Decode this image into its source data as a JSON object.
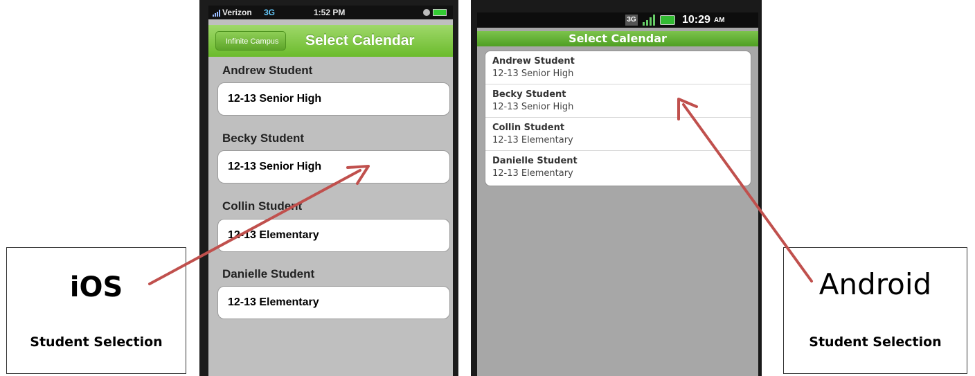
{
  "callouts": {
    "ios": {
      "platform": "iOS",
      "subtitle": "Student Selection"
    },
    "android": {
      "platform": "Android",
      "subtitle": "Student Selection"
    }
  },
  "ios": {
    "status": {
      "carrier": "Verizon",
      "network": "3G",
      "time": "1:52 PM"
    },
    "nav": {
      "back_label": "Infinite Campus",
      "title": "Select Calendar"
    },
    "students": [
      {
        "name": "Andrew Student",
        "calendar": "12-13 Senior High"
      },
      {
        "name": "Becky Student",
        "calendar": "12-13 Senior High"
      },
      {
        "name": "Collin Student",
        "calendar": "12-13 Elementary"
      },
      {
        "name": "Danielle Student",
        "calendar": "12-13 Elementary"
      }
    ]
  },
  "android": {
    "status": {
      "network": "3G",
      "time": "10:29",
      "ampm": "AM"
    },
    "title": "Select Calendar",
    "students": [
      {
        "name": "Andrew Student",
        "calendar": "12-13 Senior High"
      },
      {
        "name": "Becky Student",
        "calendar": "12-13 Senior High"
      },
      {
        "name": "Collin Student",
        "calendar": "12-13 Elementary"
      },
      {
        "name": "Danielle Student",
        "calendar": "12-13 Elementary"
      }
    ]
  },
  "colors": {
    "arrow": "#c0504d",
    "ios_nav": "#7cc43c",
    "android_title": "#5faf2d"
  }
}
